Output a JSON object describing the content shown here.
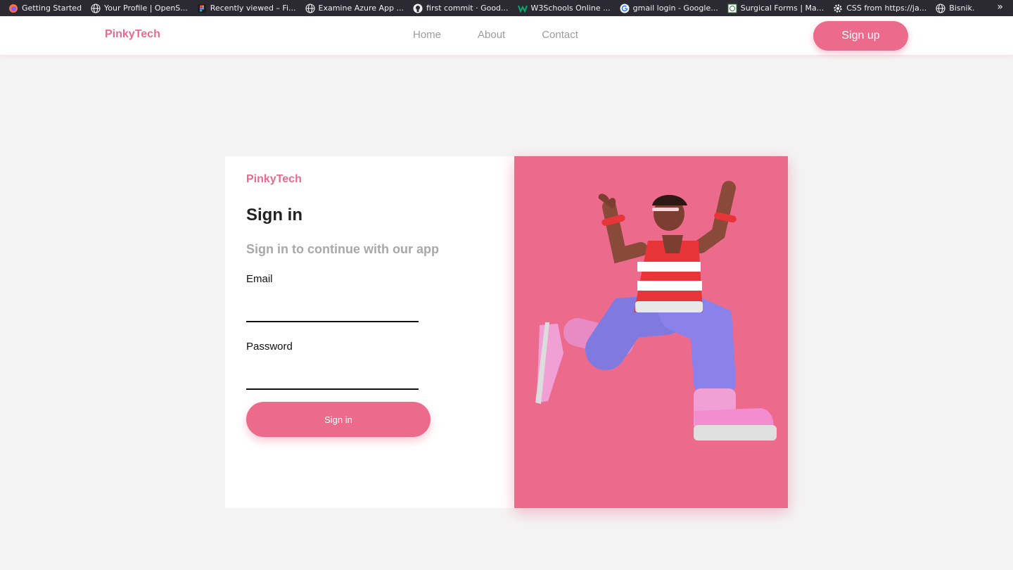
{
  "bookmarks": [
    {
      "label": "Getting Started",
      "icon": "firefox-icon"
    },
    {
      "label": "Your Profile | OpenS...",
      "icon": "globe-icon"
    },
    {
      "label": "Recently viewed – Fi...",
      "icon": "figma-icon"
    },
    {
      "label": "Examine Azure App ...",
      "icon": "globe-icon"
    },
    {
      "label": "first commit · Good...",
      "icon": "github-icon"
    },
    {
      "label": "W3Schools Online ...",
      "icon": "w3schools-icon"
    },
    {
      "label": "gmail login - Google...",
      "icon": "google-icon"
    },
    {
      "label": "Surgical Forms | Ma...",
      "icon": "site-icon"
    },
    {
      "label": "CSS from https://ja...",
      "icon": "gear-icon"
    },
    {
      "label": "Bisnik.",
      "icon": "globe-icon"
    }
  ],
  "nav": {
    "brand": "PinkyTech",
    "links": [
      "Home",
      "About",
      "Contact"
    ],
    "signup_label": "Sign up"
  },
  "form": {
    "brand": "PinkyTech",
    "title": "Sign in",
    "subtitle": "Sign in to continue with our app",
    "email_label": "Email",
    "email_value": "",
    "password_label": "Password",
    "password_value": "",
    "submit_label": "Sign in"
  },
  "colors": {
    "accent": "#ec6b8d",
    "background": "#f4f4f4"
  }
}
